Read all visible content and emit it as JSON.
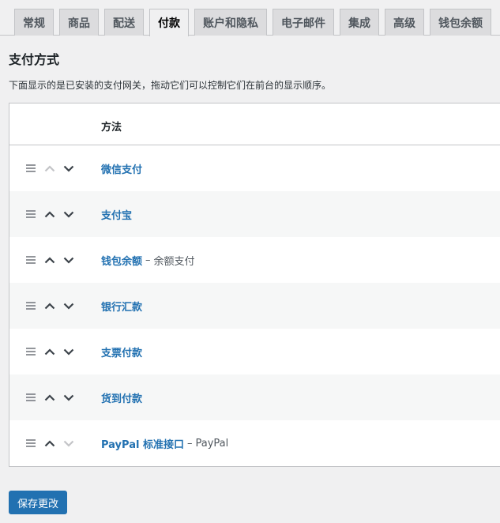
{
  "tabs": [
    {
      "label": "常规",
      "active": false
    },
    {
      "label": "商品",
      "active": false
    },
    {
      "label": "配送",
      "active": false
    },
    {
      "label": "付款",
      "active": true
    },
    {
      "label": "账户和隐私",
      "active": false
    },
    {
      "label": "电子邮件",
      "active": false
    },
    {
      "label": "集成",
      "active": false
    },
    {
      "label": "高级",
      "active": false
    },
    {
      "label": "钱包余额",
      "active": false
    }
  ],
  "section": {
    "title": "支付方式",
    "description": "下面显示的是已安装的支付网关，拖动它们可以控制它们在前台的显示顺序。"
  },
  "table": {
    "header_method": "方法",
    "rows": [
      {
        "name": "微信支付",
        "subtitle": "",
        "up_enabled": false,
        "down_enabled": true
      },
      {
        "name": "支付宝",
        "subtitle": "",
        "up_enabled": true,
        "down_enabled": true
      },
      {
        "name": "钱包余额",
        "subtitle": "余额支付",
        "up_enabled": true,
        "down_enabled": true
      },
      {
        "name": "银行汇款",
        "subtitle": "",
        "up_enabled": true,
        "down_enabled": true
      },
      {
        "name": "支票付款",
        "subtitle": "",
        "up_enabled": true,
        "down_enabled": true
      },
      {
        "name": "货到付款",
        "subtitle": "",
        "up_enabled": true,
        "down_enabled": true
      },
      {
        "name": "PayPal 标准接口",
        "subtitle": "PayPal",
        "up_enabled": true,
        "down_enabled": false
      }
    ]
  },
  "buttons": {
    "save_label": "保存更改"
  },
  "colors": {
    "accent": "#2271b1",
    "arrow_enabled": "#3c434a",
    "arrow_disabled": "#c3c4c7",
    "drag_handle": "#787c82"
  },
  "icons": {
    "drag": "drag-handle-icon",
    "up": "chevron-up-icon",
    "down": "chevron-down-icon"
  }
}
